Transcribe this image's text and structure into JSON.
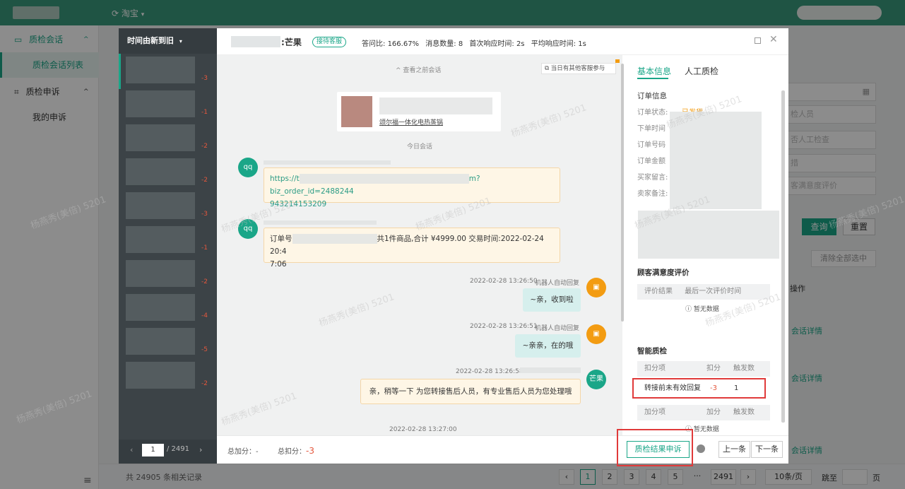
{
  "app": {
    "shop_label": "淘宝"
  },
  "sidebar": {
    "groups": [
      {
        "label": "质检会话",
        "items": [
          {
            "label": "质检会话列表",
            "active": true
          }
        ]
      },
      {
        "label": "质检申诉",
        "items": [
          {
            "label": "我的申诉",
            "active": false
          }
        ]
      }
    ]
  },
  "background": {
    "query_label": "查询",
    "reset_label": "重置",
    "clear_label": "清除全部选中",
    "op_header": "操作",
    "detail_link": "会话详情",
    "inputs": [
      "检人员",
      "否人工检查",
      "措",
      "客满意度评价"
    ],
    "total_text": "共 24905 条相关记录",
    "pages": [
      "1",
      "2",
      "3",
      "4",
      "5",
      "2491"
    ],
    "ellipsis": "···",
    "page_size": "10条/页",
    "jump_label": "跳至",
    "page_suffix": "页"
  },
  "list": {
    "sort_label": "时间由新到旧",
    "scores": [
      "-3",
      "-1",
      "-2",
      "-2",
      "-3",
      "-1",
      "-2",
      "-4",
      "-5",
      "-2"
    ],
    "pager": {
      "current": "1",
      "total": "/ 2491"
    }
  },
  "chat_header": {
    "name_suffix": "芒果",
    "tag": "接待客服",
    "stats": [
      {
        "label": "答问比",
        "value": "166.67%"
      },
      {
        "label": "消息数量",
        "value": "8"
      },
      {
        "label": "首次响应时间",
        "value": "2s"
      },
      {
        "label": "平均响应时间",
        "value": "1s"
      }
    ]
  },
  "chat": {
    "view_prev": "查看之前会话",
    "other_cs": "当日有其他客服参与",
    "today_label": "今日会话",
    "product_text": "颂尔福一体化电热蒸锅",
    "messages": [
      {
        "side": "left",
        "avatar": "qq",
        "text1": "https://t",
        "text2": "m?biz_order_id=2488244",
        "text3": "943214153209"
      },
      {
        "side": "left",
        "avatar": "qq",
        "text1": "订单号",
        "text2": "共1件商品,合计 ¥4999.00 交易时间:2022-02-24 20:4",
        "text3": "7:06"
      },
      {
        "side": "right",
        "time": "2022-02-28 13:26:50",
        "tag": "机器人自动回复",
        "text": "~亲，收到啦"
      },
      {
        "side": "right",
        "time": "2022-02-28 13:26:51",
        "tag": "机器人自动回复",
        "text": "~亲亲，在的哦"
      },
      {
        "side": "right",
        "time": "2022-02-28 13:26:58",
        "avatar": "芒果",
        "text": "亲，稍等一下 为您转接售后人员，有专业售后人员为您处理哦"
      }
    ],
    "last_time": "2022-02-28 13:27:00"
  },
  "right_panel": {
    "tabs": [
      "基本信息",
      "人工质检"
    ],
    "order_title": "订单信息",
    "order_fields": [
      "订单状态:",
      "下单时间",
      "订单号码",
      "订单金额",
      "买家留言:",
      "卖家备注:"
    ],
    "order_status": "已发货",
    "satisfaction_title": "顾客满意度评价",
    "satisfaction_cols": [
      "评价结果",
      "最后一次评价时间"
    ],
    "no_data": "暂无数据",
    "smart_title": "智能质检",
    "deduct_cols": [
      "扣分项",
      "扣分",
      "触发数"
    ],
    "deduct_row": {
      "item": "转接前未有效回复",
      "score": "-3",
      "count": "1"
    },
    "add_cols": [
      "加分项",
      "加分",
      "触发数"
    ],
    "no_data2": "暂无数据"
  },
  "footer": {
    "add_label": "总加分：",
    "add_value": "-",
    "sub_label": "总扣分：",
    "sub_value": "-3",
    "appeal_button": "质检结果申诉",
    "prev_button": "上一条",
    "next_button": "下一条"
  },
  "watermark": "杨燕秀(美倍) 5201",
  "colors": {
    "brand": "#1aa688",
    "topbar": "#3a9a7c",
    "danger": "#e4573d",
    "robot": "#f39c12"
  }
}
